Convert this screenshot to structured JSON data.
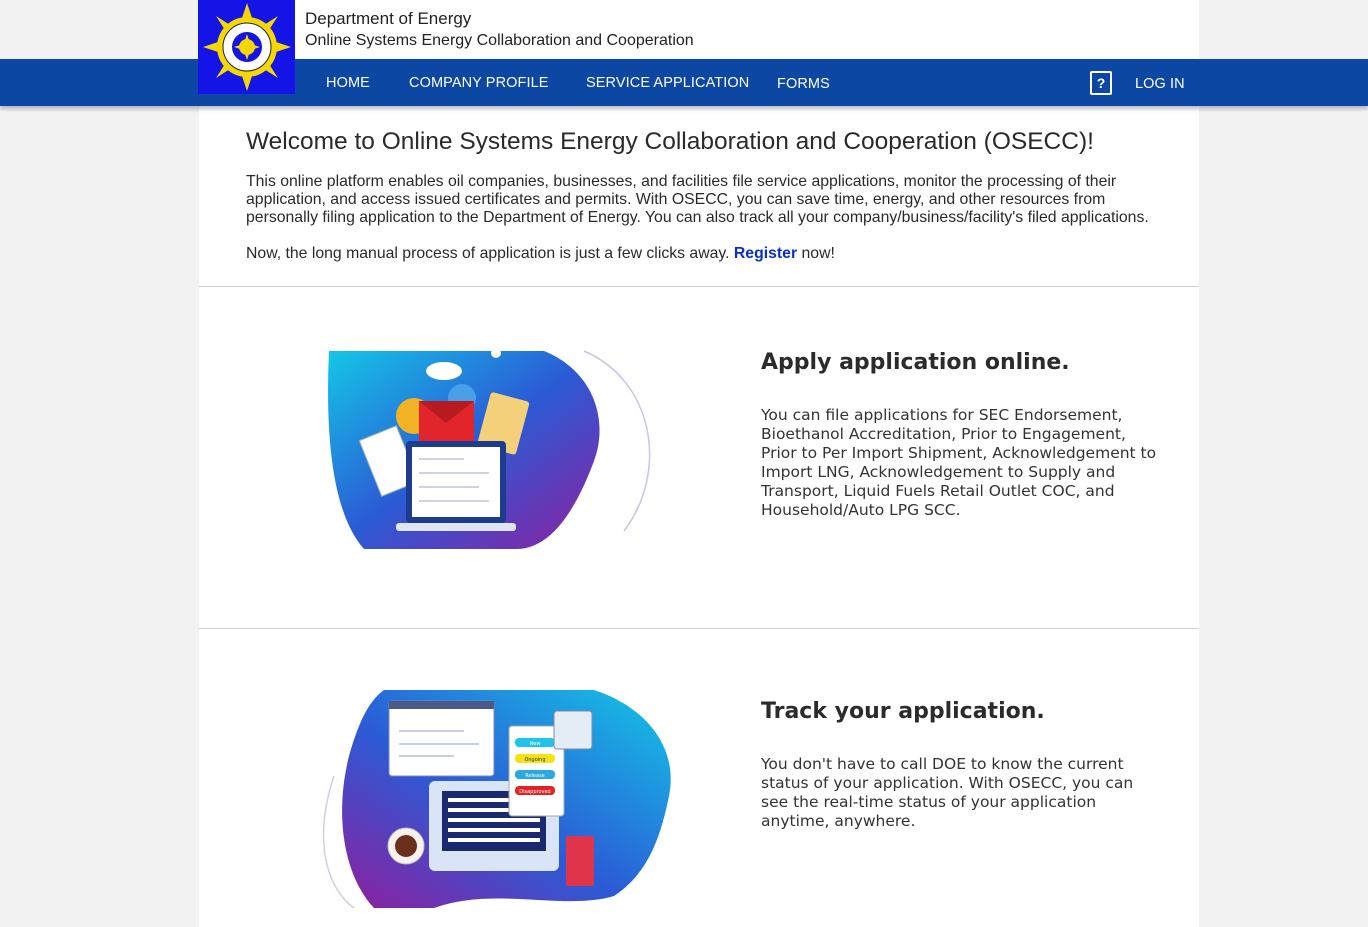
{
  "header": {
    "org_name": "Department of Energy",
    "org_subtitle": "Online Systems Energy Collaboration and Cooperation"
  },
  "nav": {
    "items": [
      {
        "label": "HOME"
      },
      {
        "label": "COMPANY PROFILE"
      },
      {
        "label": "SERVICE APPLICATION"
      },
      {
        "label": "FORMS"
      }
    ],
    "help_icon": "help-icon",
    "login_label": "LOG IN"
  },
  "welcome": {
    "title": "Welcome to Online Systems Energy Collaboration and Cooperation (OSECC)!",
    "intro": "This online platform enables oil companies, businesses, and facilities file service applications, monitor the processing of their application, and access issued certificates and permits. With OSECC, you can save time, energy, and other resources from personally filing application to the Department of Energy. You can also track all your company/business/facility's filed applications.",
    "cta_before": "Now, the long manual process of application is just a few clicks away. ",
    "cta_link": "Register",
    "cta_after": " now!"
  },
  "features": [
    {
      "title": "Apply application online.",
      "text": "You can file applications for SEC Endorsement, Bioethanol Accreditation, Prior to Engagement, Prior to Per Import Shipment, Acknowledgement to Import LNG, Acknowledgement to Supply and Transport, Liquid Fuels Retail Outlet COC, and Household/Auto LPG SCC."
    },
    {
      "title": "Track your application.",
      "text": "You don't have to call DOE to know the current status of your application. With OSECC, you can see the real-time status of your application anytime, anywhere.",
      "status_labels": [
        "New",
        "Ongoing",
        "Release",
        "Disapproved"
      ]
    }
  ],
  "colors": {
    "nav": "#0c48a3",
    "logo_bg": "#1414e6",
    "link": "#0a2fc9"
  }
}
